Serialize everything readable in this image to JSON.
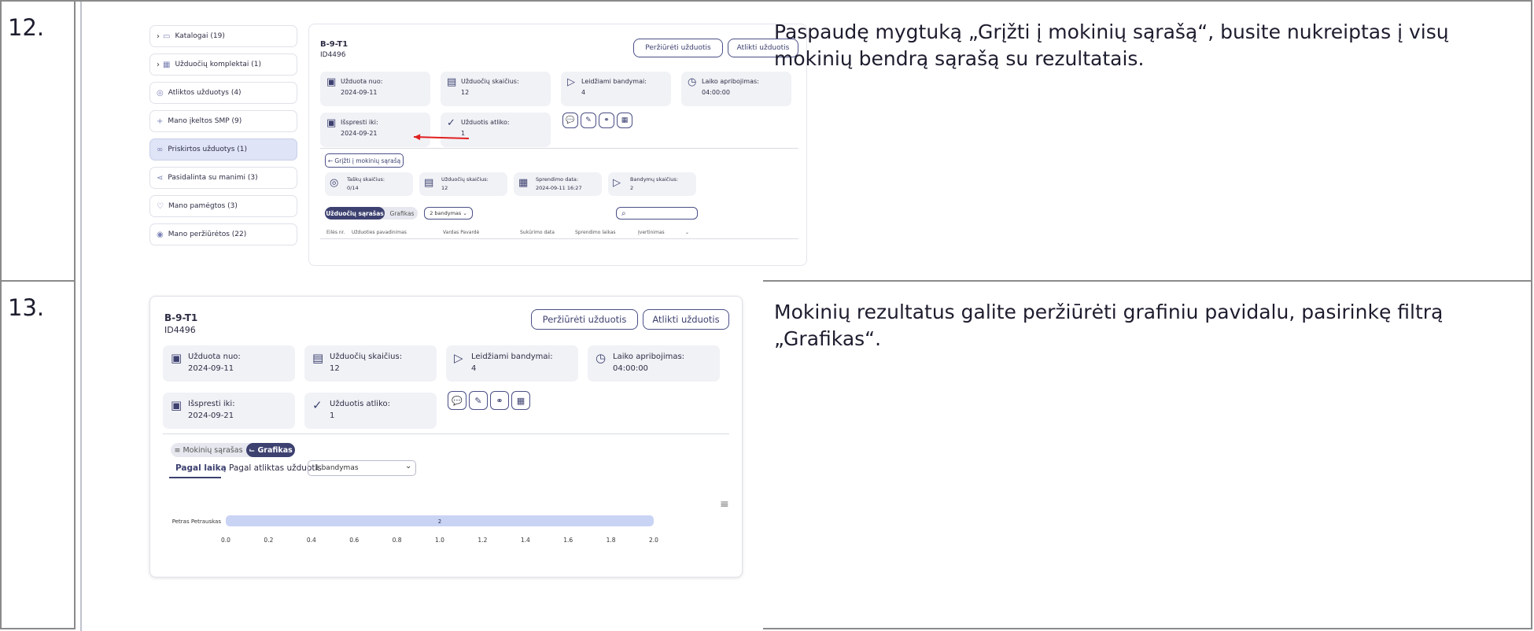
{
  "rows": [
    {
      "number": "12.",
      "description": [
        "Paspaudę mygtuką „Grįžti į mokinių sąrašą“, busite nukreiptas į visų",
        "mokinių bendrą sąrašą su rezultatais."
      ]
    },
    {
      "number": "13.",
      "description": [
        "Mokinių rezultatus galite peržiūrėti grafiniu pavidalu, pasirinkę filtrą",
        "„Grafikas“."
      ]
    }
  ],
  "shot1": {
    "sidebar": [
      {
        "icon": "folder-icon",
        "glyph": "▭",
        "label": "Katalogai  (19)",
        "chevron": "›"
      },
      {
        "icon": "grid-icon",
        "glyph": "▦",
        "label": "Užduočių komplektai  (1)",
        "chevron": "›"
      },
      {
        "icon": "check-circle-icon",
        "glyph": "◎",
        "label": "Atliktos užduotys  (4)",
        "chevron": ""
      },
      {
        "icon": "plus-icon",
        "glyph": "+",
        "label": "Mano įkeltos SMP  (9)",
        "chevron": ""
      },
      {
        "icon": "link-icon",
        "glyph": "∞",
        "label": "Priskirtos užduotys  (1)",
        "chevron": ""
      },
      {
        "icon": "share-icon",
        "glyph": "⋖",
        "label": "Pasidalinta su manimi  (3)",
        "chevron": ""
      },
      {
        "icon": "heart-icon",
        "glyph": "♡",
        "label": "Mano pamėgtos  (3)",
        "chevron": ""
      },
      {
        "icon": "eye-icon",
        "glyph": "◉",
        "label": "Mano peržiūrėtos  (22)",
        "chevron": ""
      }
    ],
    "title": "B-9-T1",
    "id": "ID4496",
    "view_btn": "Peržiūrėti užduotis",
    "do_btn": "Atlikti užduotis",
    "cards": [
      {
        "label": "Užduota nuo:",
        "value": "2024-09-11",
        "icon": "calendar-icon",
        "glyph": "▣"
      },
      {
        "label": "Užduočių skaičius:",
        "value": "12",
        "icon": "list-icon",
        "glyph": "▤"
      },
      {
        "label": "Leidžiami bandymai:",
        "value": "4",
        "icon": "play-icon",
        "glyph": "▷"
      },
      {
        "label": "Laiko apribojimas:",
        "value": "04:00:00",
        "icon": "clock-icon",
        "glyph": "◷"
      },
      {
        "label": "Išspresti iki:",
        "value": "2024-09-21",
        "icon": "calendar-icon",
        "glyph": "▣"
      },
      {
        "label": "Užduotis atliko:",
        "value": "1",
        "icon": "check-circle-icon",
        "glyph": "✓"
      }
    ],
    "action_icons": [
      {
        "icon": "comment-icon",
        "glyph": "💬"
      },
      {
        "icon": "edit-icon",
        "glyph": "✎"
      },
      {
        "icon": "link-icon",
        "glyph": "⚭"
      },
      {
        "icon": "calendar-icon",
        "glyph": "▦"
      }
    ],
    "back_btn": "← Grįžti į mokinių sąrašą",
    "stats": [
      {
        "label": "Taškų skaičius:",
        "value": "0/14",
        "icon": "target-icon",
        "glyph": "◎"
      },
      {
        "label": "Užduočių skaičius:",
        "value": "12",
        "icon": "list-icon",
        "glyph": "▤"
      },
      {
        "label": "Sprendimo data:",
        "value": "2024-09-11 16:27",
        "icon": "calendar-icon",
        "glyph": "▦"
      },
      {
        "label": "Bandymų skaičius:",
        "value": "2",
        "icon": "play-icon",
        "glyph": "▷"
      }
    ],
    "tab_active": "Užduočių sąrašas",
    "tab_other": "Grafikas",
    "attempts_select": "2 bandymas  ⌄",
    "search_glyph": "⌕",
    "columns": [
      "Eilės nr.",
      "Užduoties pavadinimas",
      "Vardas Pavardė",
      "Sukūrimo data",
      "Sprendimo laikas",
      "Įvertinimas",
      "⌄"
    ]
  },
  "shot2": {
    "title": "B-9-T1",
    "id": "ID4496",
    "view_btn": "Peržiūrėti užduotis",
    "do_btn": "Atlikti užduotis",
    "cards": [
      {
        "label": "Užduota nuo:",
        "value": "2024-09-11",
        "icon": "calendar-icon",
        "glyph": "▣"
      },
      {
        "label": "Užduočių skaičius:",
        "value": "12",
        "icon": "list-icon",
        "glyph": "▤"
      },
      {
        "label": "Leidžiami bandymai:",
        "value": "4",
        "icon": "play-icon",
        "glyph": "▷"
      },
      {
        "label": "Laiko apribojimas:",
        "value": "04:00:00",
        "icon": "clock-icon",
        "glyph": "◷"
      },
      {
        "label": "Išspresti iki:",
        "value": "2024-09-21",
        "icon": "calendar-icon",
        "glyph": "▣"
      },
      {
        "label": "Užduotis atliko:",
        "value": "1",
        "icon": "check-circle-icon",
        "glyph": "✓"
      }
    ],
    "action_icons": [
      {
        "icon": "comment-icon",
        "glyph": "💬"
      },
      {
        "icon": "edit-icon",
        "glyph": "✎"
      },
      {
        "icon": "link-icon",
        "glyph": "⚭"
      },
      {
        "icon": "calendar-icon",
        "glyph": "▦"
      }
    ],
    "toggle_list": "≡ Mokinių sąrašas",
    "toggle_chart": "⌙ Grafikas",
    "subtab_time": "Pagal laiką",
    "subtab_done": "Pagal atliktas užduotis",
    "attempt_select": "1 bandymas",
    "menu_glyph": "≡",
    "chart_data": {
      "type": "bar",
      "orientation": "horizontal",
      "categories": [
        "Petras Petrauskas"
      ],
      "values": [
        2
      ],
      "data_labels": [
        "2"
      ],
      "xlim": [
        0,
        2
      ],
      "ticks": [
        "0.0",
        "0.2",
        "0.4",
        "0.6",
        "0.8",
        "1.0",
        "1.2",
        "1.4",
        "1.6",
        "1.8",
        "2.0"
      ],
      "bar_color": "#c9d4f5"
    }
  }
}
